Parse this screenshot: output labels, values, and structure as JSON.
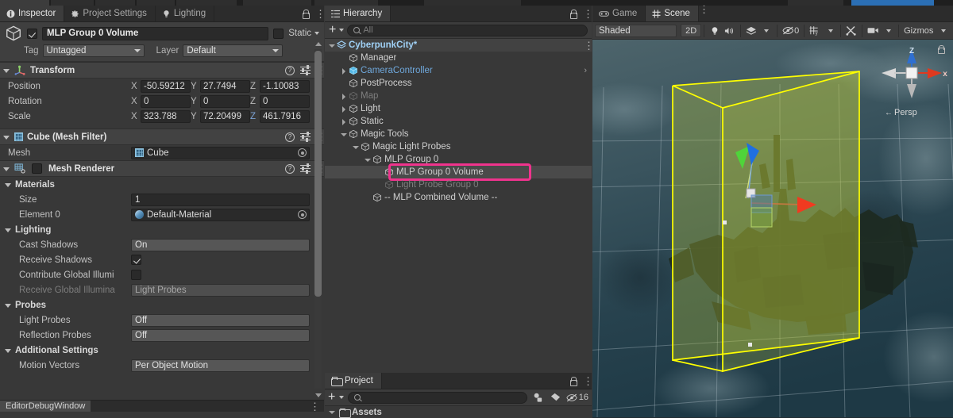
{
  "inspector": {
    "tabs": [
      {
        "label": "Inspector",
        "icon": "info-icon",
        "active": true
      },
      {
        "label": "Project Settings",
        "icon": "gear-icon",
        "active": false
      },
      {
        "label": "Lighting",
        "icon": "bulb-icon",
        "active": false
      }
    ],
    "gameobject": {
      "enabled": true,
      "name": "MLP Group 0 Volume",
      "static_label": "Static",
      "static_checked": false,
      "tag_label": "Tag",
      "tag_value": "Untagged",
      "layer_label": "Layer",
      "layer_value": "Default"
    },
    "transform": {
      "title": "Transform",
      "rows": [
        {
          "label": "Position",
          "x": "-50.59212",
          "y": "27.7494",
          "z": "-1.10083"
        },
        {
          "label": "Rotation",
          "x": "0",
          "y": "0",
          "z": "0"
        },
        {
          "label": "Scale",
          "x": "323.788",
          "y": "72.20499",
          "z": "461.7916"
        }
      ],
      "axis_labels": [
        "X",
        "Y",
        "Z"
      ]
    },
    "mesh_filter": {
      "title": "Cube (Mesh Filter)",
      "mesh_label": "Mesh",
      "mesh_value": "Cube"
    },
    "mesh_renderer": {
      "title": "Mesh Renderer",
      "enabled": false,
      "materials": {
        "title": "Materials",
        "size_label": "Size",
        "size_value": "1",
        "element_label": "Element 0",
        "element_value": "Default-Material"
      },
      "lighting": {
        "title": "Lighting",
        "cast_shadows_label": "Cast Shadows",
        "cast_shadows_value": "On",
        "receive_shadows_label": "Receive Shadows",
        "receive_shadows_checked": true,
        "contribute_gi_label": "Contribute Global Illumi",
        "contribute_gi_checked": false,
        "receive_gi_label": "Receive Global Illumina",
        "receive_gi_value": "Light Probes"
      },
      "probes": {
        "title": "Probes",
        "light_probes_label": "Light Probes",
        "light_probes_value": "Off",
        "reflection_probes_label": "Reflection Probes",
        "reflection_probes_value": "Off"
      },
      "additional": {
        "title": "Additional Settings",
        "motion_vectors_label": "Motion Vectors",
        "motion_vectors_value": "Per Object Motion"
      }
    },
    "bottom_tab": "EditorDebugWindow"
  },
  "hierarchy": {
    "tab_label": "Hierarchy",
    "search_placeholder": "All",
    "items": [
      {
        "label": "CyberpunkCity*",
        "depth": 0,
        "arrow": "open",
        "style": "scene",
        "selected": false,
        "kebab": true
      },
      {
        "label": "Manager",
        "depth": 1,
        "arrow": "none",
        "style": "normal",
        "selected": false
      },
      {
        "label": "CameraController",
        "depth": 1,
        "arrow": "closed",
        "style": "prefab",
        "selected": false,
        "chevron": true
      },
      {
        "label": "PostProcess",
        "depth": 1,
        "arrow": "none",
        "style": "normal",
        "selected": false
      },
      {
        "label": "Map",
        "depth": 1,
        "arrow": "closed",
        "style": "dim",
        "selected": false
      },
      {
        "label": "Light",
        "depth": 1,
        "arrow": "closed",
        "style": "normal",
        "selected": false
      },
      {
        "label": "Static",
        "depth": 1,
        "arrow": "closed",
        "style": "normal",
        "selected": false
      },
      {
        "label": "Magic Tools",
        "depth": 1,
        "arrow": "open",
        "style": "normal",
        "selected": false
      },
      {
        "label": "Magic Light Probes",
        "depth": 2,
        "arrow": "open",
        "style": "normal",
        "selected": false
      },
      {
        "label": "MLP Group 0",
        "depth": 3,
        "arrow": "open",
        "style": "normal",
        "selected": false
      },
      {
        "label": "MLP Group 0 Volume",
        "depth": 4,
        "arrow": "none",
        "style": "normal",
        "selected": true,
        "highlight": true
      },
      {
        "label": "Light Probe Group 0",
        "depth": 4,
        "arrow": "none",
        "style": "dim",
        "selected": false
      },
      {
        "label": "-- MLP Combined Volume --",
        "depth": 3,
        "arrow": "none",
        "style": "normal",
        "selected": false
      }
    ],
    "highlight_color": "#f0338d"
  },
  "project": {
    "tab_label": "Project",
    "search_placeholder": "",
    "hidden_count": "16",
    "assets_label": "Assets"
  },
  "scene": {
    "tabs": [
      {
        "label": "Game",
        "icon": "gamepad-icon",
        "active": false
      },
      {
        "label": "Scene",
        "icon": "grid-icon",
        "active": true
      }
    ],
    "toolbar": {
      "draw_mode": "Shaded",
      "mode_2d": "2D",
      "lighting_icon": "bulb-icon",
      "audio_icon": "speaker-icon",
      "fx_icon": "fx-icon",
      "hidden_objects_count": "0",
      "grid_icon": "grid-snap-icon",
      "tools_icon": "tools-icon",
      "camera_icon": "camera-icon",
      "gizmos_label": "Gizmos"
    },
    "gizmo": {
      "axis_z": "Z",
      "axis_x": "x",
      "projection": "Persp"
    },
    "selection_bounds_color": "#ffff00",
    "background_top": "#3a4f57",
    "background_bottom": "#20343e"
  }
}
